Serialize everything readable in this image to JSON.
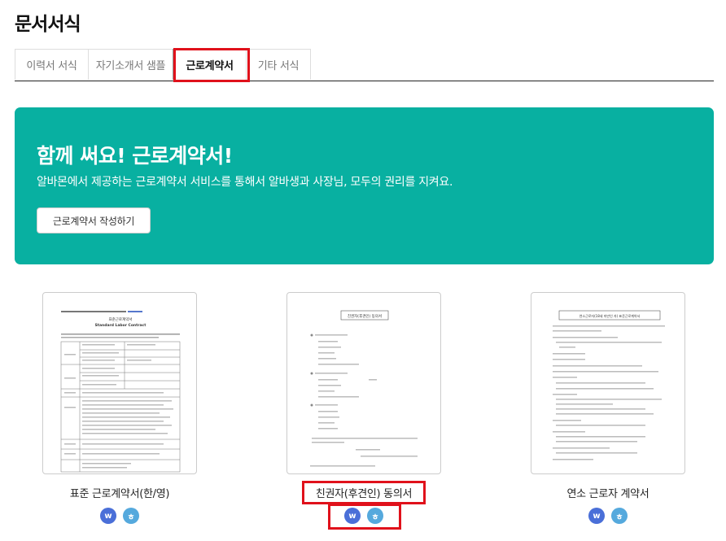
{
  "page": {
    "title": "문서서식"
  },
  "tabs": [
    {
      "label": "이력서 서식",
      "active": false
    },
    {
      "label": "자기소개서 샘플",
      "active": false
    },
    {
      "label": "근로계약서",
      "active": true
    },
    {
      "label": "기타 서식",
      "active": false
    }
  ],
  "banner": {
    "title": "함께 써요! 근로계약서!",
    "description": "알바몬에서 제공하는 근로계약서 서비스를 통해서 알바생과 사장님, 모두의 권리를 지켜요.",
    "button_label": "근로계약서 작성하기",
    "background_color": "#08b0a1"
  },
  "documents": [
    {
      "title": "표준 근로계약서(한/영)",
      "thumb_heading": "표준근로계약서",
      "thumb_subheading": "Standard Labor Contract",
      "icons": [
        "w",
        "ㅎ"
      ]
    },
    {
      "title": "친권자(후견인) 동의서",
      "thumb_heading": "친권자(후견인) 동의서",
      "icons": [
        "w",
        "ㅎ"
      ]
    },
    {
      "title": "연소 근로자 계약서",
      "thumb_heading": "연소근로자(18세 미만인 자) 표준근로계약서",
      "icons": [
        "w",
        "ㅎ"
      ]
    }
  ],
  "icon_names": {
    "word": "word-doc-icon",
    "hwp": "hwp-doc-icon"
  },
  "colors": {
    "highlight": "#e0111b",
    "word_icon": "#4a6fd8",
    "hwp_icon": "#55a9dd"
  }
}
